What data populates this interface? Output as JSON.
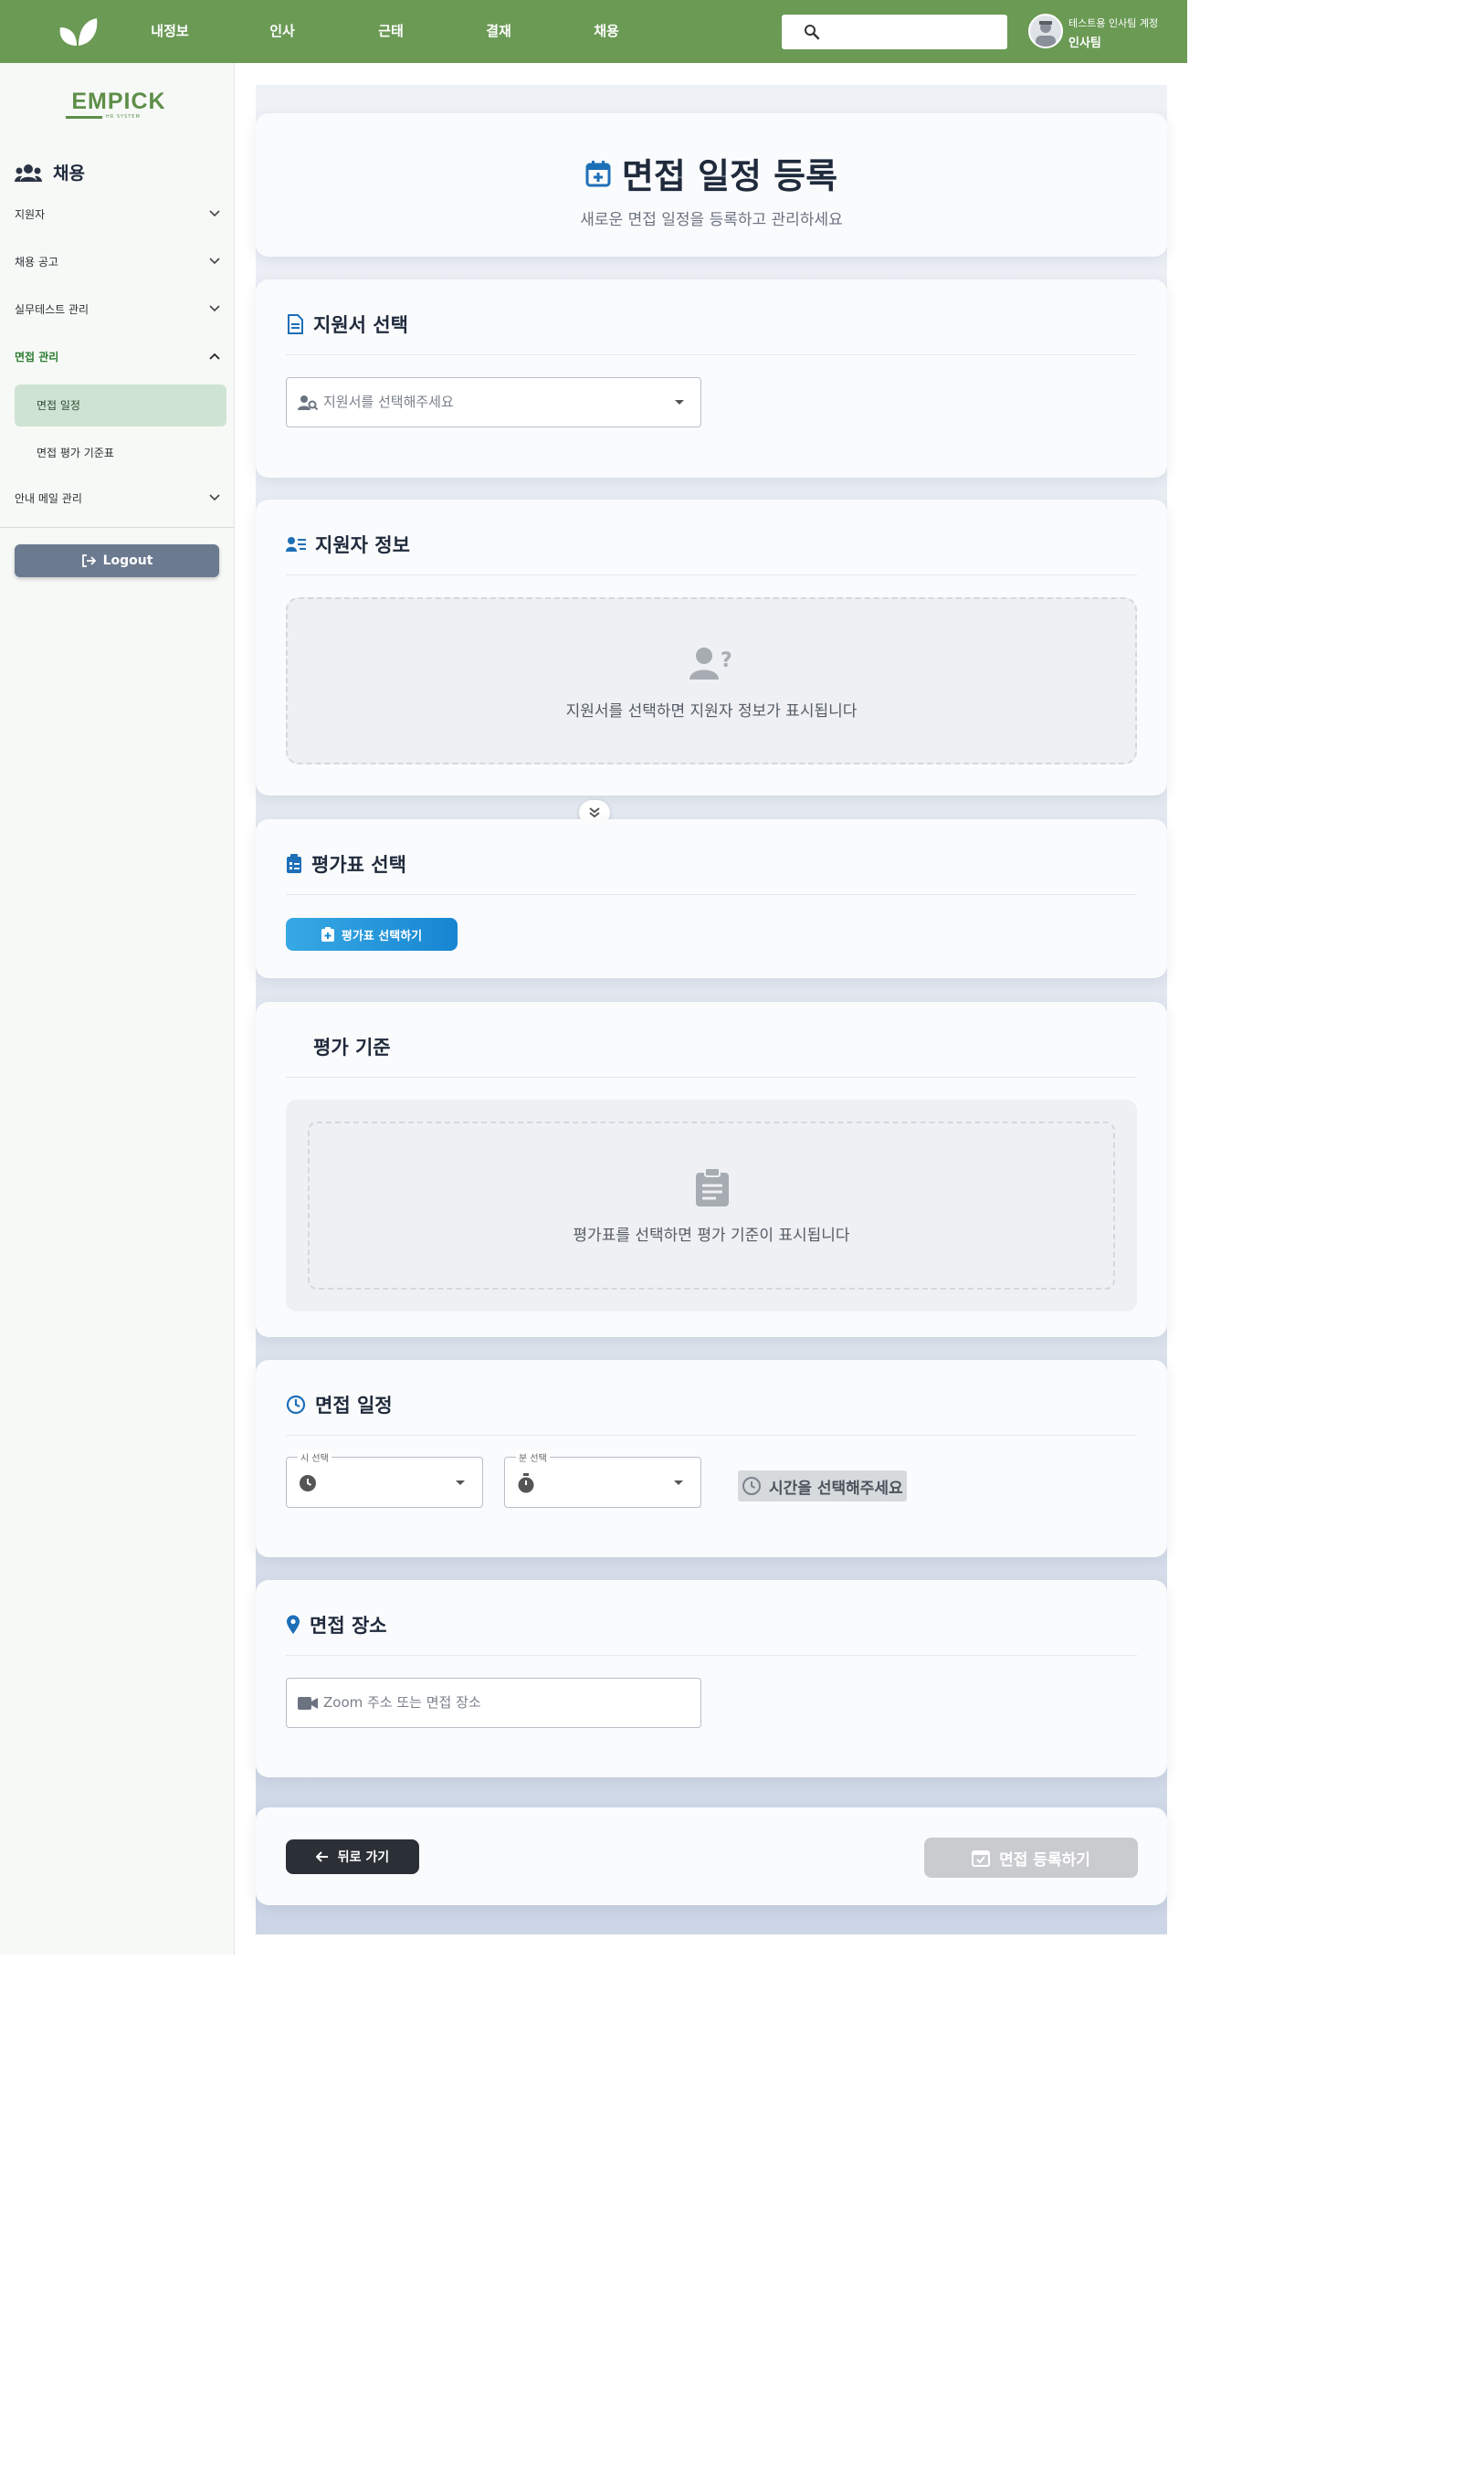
{
  "nav": {
    "items": [
      "내정보",
      "인사",
      "근태",
      "결재",
      "채용"
    ],
    "search_placeholder": "",
    "user_sub": "테스트용 인사팀 계정",
    "user_name": "인사팀"
  },
  "sidebar": {
    "logo": "EMPICK",
    "logo_sub": "HR SYSTEM",
    "section_title": "채용",
    "items": [
      {
        "label": "지원자"
      },
      {
        "label": "채용 공고"
      },
      {
        "label": "실무테스트 관리"
      },
      {
        "label": "면접 관리"
      },
      {
        "label": "안내 메일 관리"
      }
    ],
    "sub_items": [
      "면접 일정",
      "면접 평가 기준표"
    ],
    "logout": "Logout"
  },
  "page": {
    "title": "면접 일정 등록",
    "subtitle": "새로운 면접 일정을 등록하고 관리하세요"
  },
  "sections": {
    "application": {
      "title": "지원서 선택",
      "placeholder": "지원서를 선택해주세요"
    },
    "applicant": {
      "title": "지원자 정보",
      "empty_text": "지원서를 선택하면 지원자 정보가 표시됩니다"
    },
    "eval_sheet": {
      "title": "평가표 선택",
      "button": "평가표 선택하기"
    },
    "criteria": {
      "title": "평가 기준",
      "empty_text": "평가표를 선택하면 평가 기준이 표시됩니다"
    },
    "schedule": {
      "title": "면접 일정",
      "hour_label": "시 선택",
      "minute_label": "분 선택",
      "time_hint": "시간을 선택해주세요"
    },
    "location": {
      "title": "면접 장소",
      "placeholder": "Zoom 주소 또는 면접 장소"
    }
  },
  "actions": {
    "back": "뒤로 가기",
    "submit": "면접 등록하기"
  },
  "colors": {
    "nav_green": "#6b9a55",
    "accent_blue": "#1d6fb8",
    "selected_bg": "#cfe3d3"
  }
}
